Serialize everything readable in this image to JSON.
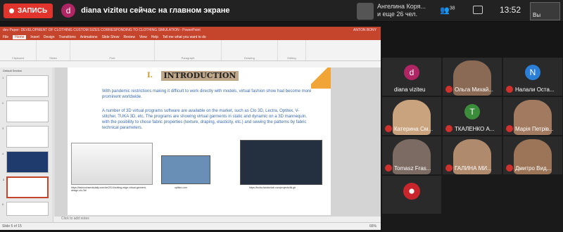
{
  "topbar": {
    "record_label": "ЗАПИСЬ",
    "presenter_initial": "d",
    "presenter_text": "diana viziteu сейчас на главном экране",
    "participants_text": "Ангелина Коря... и еще 26 чел.",
    "people_count": "38",
    "clock": "13:52",
    "self_label": "Вы"
  },
  "powerpoint": {
    "title": "dev Paper: DEVELOPMENT OF CLOTHING CUSTOM SIZES CORRESPONDING TO CLOTHING SIMULATION - PowerPoint",
    "user": "ANTON BONY",
    "tabs": [
      "File",
      "Home",
      "Insert",
      "Design",
      "Transitions",
      "Animations",
      "Slide Show",
      "Review",
      "View",
      "Help",
      "Tell me what you want to do"
    ],
    "active_tab": "Home",
    "ribbon_groups": [
      "Clipboard",
      "Slides",
      "Font",
      "Paragraph",
      "Drawing",
      "Editing"
    ],
    "section": "Default Section",
    "notes_placeholder": "Click to add notes",
    "status": "Slide 5 of 15",
    "zoom": "66%",
    "slide": {
      "number": "I.",
      "heading": "INTRODUCTION",
      "p1": "With pandemic restrictions making it difficult to work directly with models, virtual fashion show had become more prominent worldwide.",
      "p2": "A number of 3D virtual programs software are available on the market, such as Clo 3D, Lectra, Optitex, V-stitcher, TUKA 3D, etc. The programs are showing virtual garments in static and dynamic on a 3D mannequin, with the posibility to chose fabric properties (texture, draping, elasticity, etc.) and sewing the patterns by fabric technical parameters.",
      "caption1": "https://fashioninsectsdaily.com/de/2014/cutting-edge-virtual-garment-design-clo-3d/",
      "caption2": "optitex.com",
      "caption3": "https://lectra.fashionlab.com/projects/tkl.gb"
    }
  },
  "gallery": [
    {
      "name": "diana viziteu",
      "initial": "d",
      "color": "#b02563",
      "muted": false
    },
    {
      "name": "Ольга Михай...",
      "muted": true
    },
    {
      "name": "Налали Оста...",
      "initial": "N",
      "color": "#2b7fd6",
      "muted": true
    },
    {
      "name": "Катерина См...",
      "muted": true
    },
    {
      "name": "ТКАЛЕНКО А...",
      "initial": "T",
      "color": "#3b8d3b",
      "muted": true
    },
    {
      "name": "Марія Петрів...",
      "muted": true
    },
    {
      "name": "Tomasz Fras...",
      "muted": true
    },
    {
      "name": "ГАЛИНА МИ...",
      "muted": true
    },
    {
      "name": "Дмитро Вид...",
      "muted": true
    }
  ]
}
